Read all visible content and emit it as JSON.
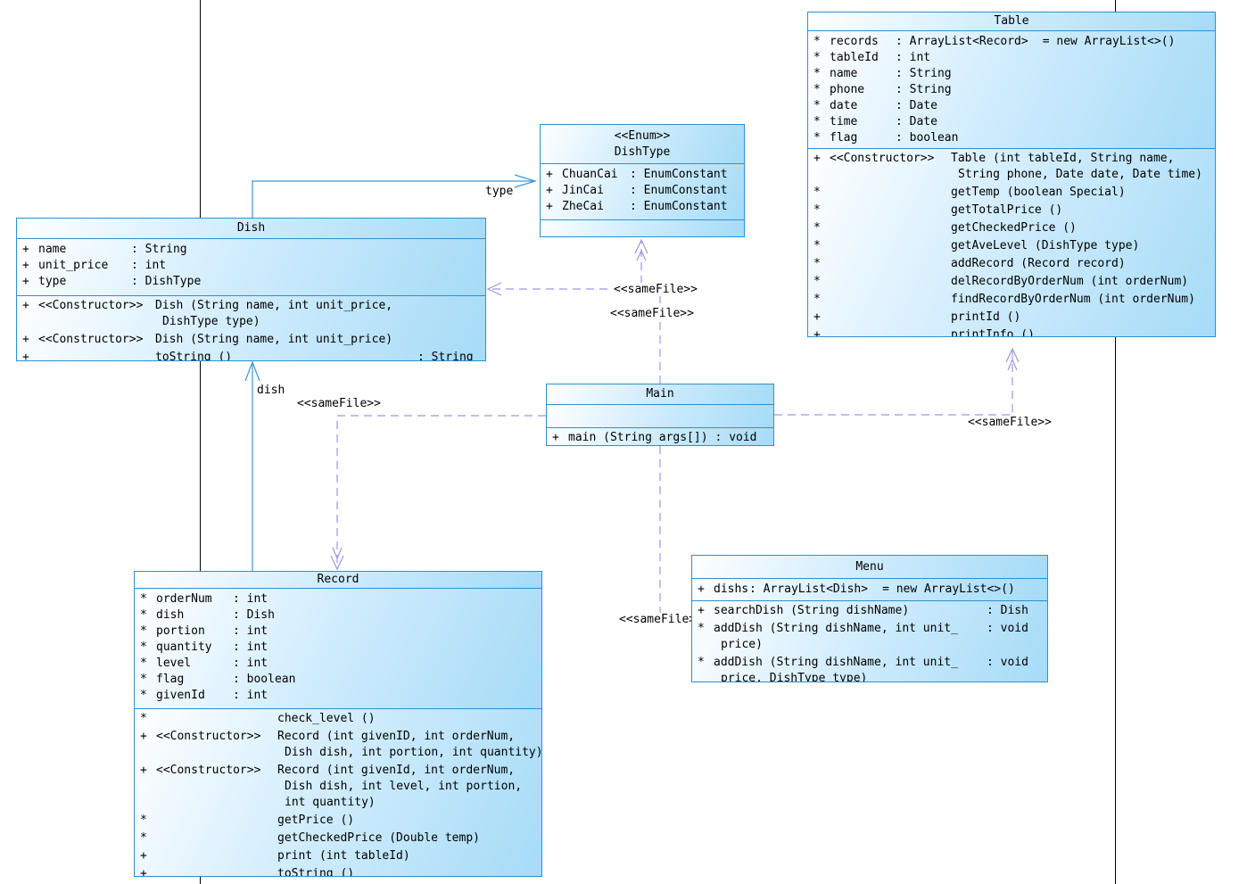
{
  "colors": {
    "border": "#2a91d2",
    "fill_mid": "#d2edfd",
    "fill_end": "#a5dbf7",
    "solid_line": "#3a96d6",
    "dashed_line": "#9a99e0",
    "divider": "#000000",
    "text": "#000000"
  },
  "classes": [
    {
      "id": "table",
      "title_lines": [
        "Table"
      ],
      "attributes": [
        {
          "v": "*",
          "n": "records",
          "t": ": ArrayList<Record>",
          "d": "= new ArrayList<>()"
        },
        {
          "v": "*",
          "n": "tableId",
          "t": ": int"
        },
        {
          "v": "*",
          "n": "name",
          "t": ": String"
        },
        {
          "v": "*",
          "n": "phone",
          "t": ": String"
        },
        {
          "v": "*",
          "n": "date",
          "t": ": Date"
        },
        {
          "v": "*",
          "n": "time",
          "t": ": Date"
        },
        {
          "v": "*",
          "n": "flag",
          "t": ": boolean"
        }
      ],
      "methods": [
        {
          "v": "+",
          "s": "<<Constructor>>",
          "lines": [
            "Table (int tableId, String name,",
            "String phone, Date date, Date time)"
          ]
        },
        {
          "v": "*",
          "lines": [
            "getTemp (boolean Special)"
          ]
        },
        {
          "v": "*",
          "lines": [
            "getTotalPrice ()"
          ]
        },
        {
          "v": "*",
          "lines": [
            "getCheckedPrice ()"
          ]
        },
        {
          "v": "*",
          "lines": [
            "getAveLevel (DishType type)"
          ]
        },
        {
          "v": "*",
          "lines": [
            "addRecord (Record record)"
          ]
        },
        {
          "v": "*",
          "lines": [
            "delRecordByOrderNum (int orderNum)"
          ]
        },
        {
          "v": "*",
          "lines": [
            "findRecordByOrderNum (int orderNum)"
          ]
        },
        {
          "v": "+",
          "lines": [
            "printId ()"
          ]
        },
        {
          "v": "+",
          "lines": [
            "printInfo ()"
          ]
        }
      ]
    },
    {
      "id": "dishtype",
      "title_lines": [
        "<<Enum>>",
        "DishType"
      ],
      "attributes": [
        {
          "v": "+",
          "n": "ChuanCai",
          "t": ": EnumConstant"
        },
        {
          "v": "+",
          "n": "JinCai",
          "t": ": EnumConstant"
        },
        {
          "v": "+",
          "n": "ZheCai",
          "t": ": EnumConstant"
        }
      ],
      "methods": []
    },
    {
      "id": "dish",
      "title_lines": [
        "Dish"
      ],
      "attributes": [
        {
          "v": "+",
          "n": "name",
          "t": ": String"
        },
        {
          "v": "+",
          "n": "unit_price",
          "t": ": int"
        },
        {
          "v": "+",
          "n": "type",
          "t": ": DishType"
        }
      ],
      "methods": [
        {
          "v": "+",
          "s": "<<Constructor>>",
          "lines": [
            "Dish (String name, int unit_price,",
            "DishType type)"
          ]
        },
        {
          "v": "+",
          "s": "<<Constructor>>",
          "lines": [
            "Dish (String name, int unit_price)"
          ]
        },
        {
          "v": "+",
          "lines": [
            "toString ()"
          ],
          "r": ": String"
        }
      ]
    },
    {
      "id": "main",
      "title_lines": [
        "Main"
      ],
      "attributes": [],
      "methods": [
        {
          "v": "+",
          "lines": [
            "main (String args[])"
          ],
          "r": ": void"
        }
      ]
    },
    {
      "id": "record",
      "title_lines": [
        "Record"
      ],
      "attributes": [
        {
          "v": "*",
          "n": "orderNum",
          "t": ": int"
        },
        {
          "v": "*",
          "n": "dish",
          "t": ": Dish"
        },
        {
          "v": "*",
          "n": "portion",
          "t": ": int"
        },
        {
          "v": "*",
          "n": "quantity",
          "t": ": int"
        },
        {
          "v": "*",
          "n": "level",
          "t": ": int"
        },
        {
          "v": "*",
          "n": "flag",
          "t": ": boolean"
        },
        {
          "v": "*",
          "n": "givenId",
          "t": ": int"
        }
      ],
      "methods": [
        {
          "v": "*",
          "lines": [
            "check_level ()"
          ]
        },
        {
          "v": "+",
          "s": "<<Constructor>>",
          "lines": [
            "Record (int givenID, int orderNum,",
            "Dish dish, int portion, int quantity)"
          ]
        },
        {
          "v": "+",
          "s": "<<Constructor>>",
          "lines": [
            "Record (int givenId, int orderNum,",
            "Dish dish, int level, int portion,",
            "int quantity)"
          ]
        },
        {
          "v": "*",
          "lines": [
            "getPrice ()"
          ]
        },
        {
          "v": "*",
          "lines": [
            "getCheckedPrice (Double temp)"
          ]
        },
        {
          "v": "+",
          "lines": [
            "print (int tableId)"
          ]
        },
        {
          "v": "+",
          "lines": [
            "toString ()"
          ]
        }
      ]
    },
    {
      "id": "menu",
      "title_lines": [
        "Menu"
      ],
      "attributes": [
        {
          "v": "+",
          "n": "dishs",
          "t": ": ArrayList<Dish>",
          "d": "= new ArrayList<>()"
        }
      ],
      "methods": [
        {
          "v": "+",
          "lines": [
            "searchDish (String dishName)"
          ],
          "r": ": Dish"
        },
        {
          "v": "*",
          "lines": [
            "addDish (String dishName, int unit_",
            "price)"
          ],
          "r": ": void"
        },
        {
          "v": "*",
          "lines": [
            "addDish (String dishName, int unit_",
            "price, DishType type)"
          ],
          "r": ": void"
        }
      ]
    }
  ],
  "relationships": [
    {
      "id": "dish-to-dishtype",
      "type": "association",
      "label": "type"
    },
    {
      "id": "record-to-dish",
      "type": "association",
      "label": "dish"
    },
    {
      "id": "main-to-dish",
      "type": "dependency",
      "label": "<<sameFile>>"
    },
    {
      "id": "main-to-dishtype",
      "type": "dependency",
      "label": "<<sameFile>>"
    },
    {
      "id": "main-to-record",
      "type": "dependency",
      "label": "<<sameFile>>"
    },
    {
      "id": "main-to-table",
      "type": "dependency",
      "label": "<<sameFile>>"
    },
    {
      "id": "main-to-menu",
      "type": "dependency",
      "label": "<<sameFile>>"
    }
  ]
}
